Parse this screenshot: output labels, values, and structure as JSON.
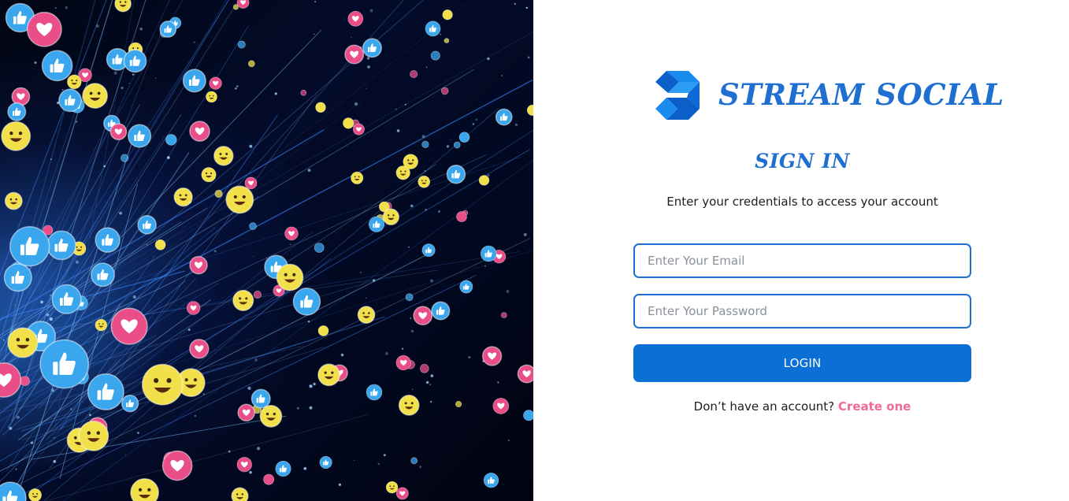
{
  "brand": {
    "name": "STREAM SOCIAL",
    "logo_icon": "stream-social-logo-icon",
    "color": "#1f6fd1"
  },
  "background_image": {
    "icons": [
      "heart-reaction-icon",
      "like-reaction-icon",
      "emoji-face-icon"
    ],
    "colors": {
      "heart": "#e94e89",
      "like": "#3aa6ee",
      "emoji": "#f2e04a",
      "background": "#030b2a"
    }
  },
  "signin": {
    "title": "SIGN IN",
    "subtitle": "Enter your credentials to access your account",
    "email_placeholder": "Enter Your Email",
    "email_value": "",
    "password_placeholder": "Enter Your Password",
    "password_value": "",
    "login_label": "LOGIN",
    "signup_prompt": "Don’t have an account?",
    "signup_link": "Create one"
  },
  "colors": {
    "accent": "#0b6fd6",
    "field_border": "#1f6fd1",
    "link": "#f06a93"
  }
}
